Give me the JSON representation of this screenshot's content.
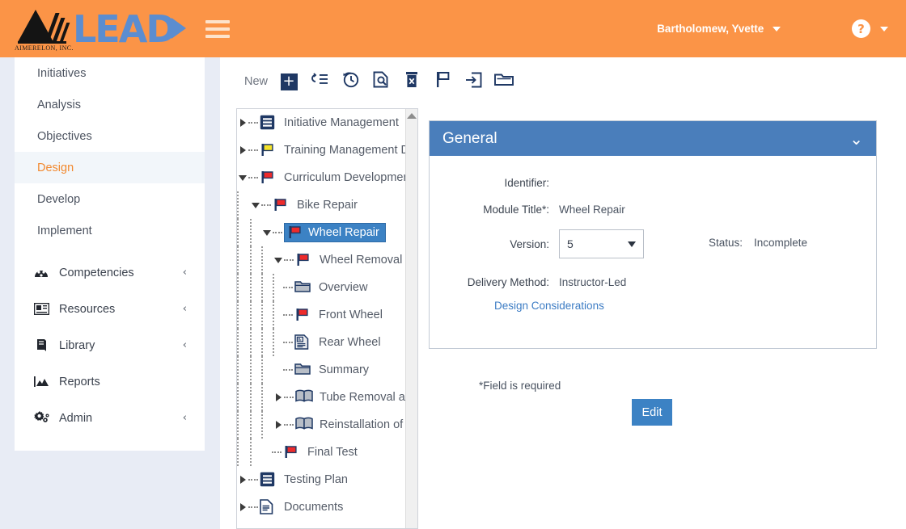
{
  "header": {
    "logo_word": "LEAD",
    "logo_sub": "AIMERELON, INC.",
    "menu_icon": "hamburger-icon",
    "user_name": "Bartholomew, Yvette",
    "help_glyph": "?"
  },
  "sidebar": {
    "items": [
      {
        "label": "Initiatives",
        "type": "link",
        "active": false
      },
      {
        "label": "Analysis",
        "type": "link",
        "active": false
      },
      {
        "label": "Objectives",
        "type": "link",
        "active": false
      },
      {
        "label": "Design",
        "type": "link",
        "active": true
      },
      {
        "label": "Develop",
        "type": "link",
        "active": false
      },
      {
        "label": "Implement",
        "type": "link",
        "active": false
      }
    ],
    "groups": [
      {
        "label": "Competencies",
        "icon": "competencies-icon",
        "chevron": "‹"
      },
      {
        "label": "Resources",
        "icon": "resources-icon",
        "chevron": "‹"
      },
      {
        "label": "Library",
        "icon": "library-icon",
        "chevron": "‹"
      },
      {
        "label": "Reports",
        "icon": "reports-icon",
        "chevron": ""
      },
      {
        "label": "Admin",
        "icon": "admin-gear-icon",
        "chevron": "‹"
      }
    ]
  },
  "toolbar": {
    "new_label": "New",
    "buttons": [
      {
        "name": "add-new-button",
        "icon": "plus-square-icon"
      },
      {
        "name": "reorder-button",
        "icon": "indent-list-icon"
      },
      {
        "name": "history-button",
        "icon": "clock-history-icon"
      },
      {
        "name": "preview-button",
        "icon": "document-search-icon"
      },
      {
        "name": "delete-button",
        "icon": "trash-icon"
      },
      {
        "name": "flag-button",
        "icon": "flag-icon"
      },
      {
        "name": "move-in-button",
        "icon": "arrow-into-box-icon"
      },
      {
        "name": "folder-button",
        "icon": "folder-icon"
      }
    ]
  },
  "tree": {
    "nodes": [
      {
        "label": "Initiative Management",
        "depth": 0,
        "toggle": "collapsed",
        "icon": "menu-blue-icon",
        "selected": false
      },
      {
        "label": "Training Management Doc",
        "depth": 0,
        "toggle": "collapsed",
        "icon": "flag-yellow-icon",
        "selected": false
      },
      {
        "label": "Curriculum Development",
        "depth": 0,
        "toggle": "expanded",
        "icon": "flag-red-icon",
        "selected": false
      },
      {
        "label": "Bike Repair",
        "depth": 1,
        "toggle": "expanded",
        "icon": "flag-red-icon",
        "selected": false
      },
      {
        "label": "Wheel Repair",
        "depth": 2,
        "toggle": "expanded",
        "icon": "flag-red-icon",
        "selected": true
      },
      {
        "label": "Wheel Removal",
        "depth": 3,
        "toggle": "expanded",
        "icon": "flag-red-icon",
        "selected": false
      },
      {
        "label": "Overview",
        "depth": 4,
        "toggle": "leaf",
        "icon": "folder-icon",
        "selected": false
      },
      {
        "label": "Front Wheel",
        "depth": 4,
        "toggle": "leaf",
        "icon": "flag-red-icon",
        "selected": false
      },
      {
        "label": "Rear Wheel",
        "depth": 4,
        "toggle": "leaf",
        "icon": "page-text-icon",
        "selected": false
      },
      {
        "label": "Summary",
        "depth": 4,
        "toggle": "leaf",
        "icon": "folder-icon",
        "selected": false
      },
      {
        "label": "Tube Removal a",
        "depth": 3,
        "toggle": "collapsed",
        "icon": "book-icon",
        "selected": false
      },
      {
        "label": "Reinstallation of",
        "depth": 3,
        "toggle": "collapsed",
        "icon": "book-icon",
        "selected": false
      },
      {
        "label": "Final Test",
        "depth": 2,
        "toggle": "leaf",
        "icon": "flag-red-icon",
        "selected": false
      },
      {
        "label": "Testing Plan",
        "depth": 0,
        "toggle": "collapsed",
        "icon": "menu-blue-icon",
        "selected": false
      },
      {
        "label": "Documents",
        "depth": 0,
        "toggle": "collapsed",
        "icon": "page-icon",
        "selected": false
      }
    ],
    "scrollbar_up_icon": "scroll-up-arrow-icon"
  },
  "general_panel": {
    "title": "General",
    "collapse_icon": "chevron-down-icon",
    "fields": {
      "identifier_label": "Identifier:",
      "identifier_value": "",
      "module_title_label": "Module Title*:",
      "module_title_value": "Wheel Repair",
      "version_label": "Version:",
      "version_value": "5",
      "status_label": "Status:",
      "status_value": "Incomplete",
      "delivery_label": "Delivery Method:",
      "delivery_value": "Instructor-Led"
    },
    "design_considerations_link": "Design Considerations"
  },
  "footer": {
    "required_note": "*Field is required",
    "edit_label": "Edit"
  },
  "colors": {
    "header_orange": "#fb9447",
    "accent_blue": "#4a7ebb",
    "button_blue": "#3c82c4",
    "active_text": "#f2892f",
    "tree_flag_red": "#ee2b2b",
    "tree_flag_yellow": "#f5e32a",
    "icon_navy": "#1f3864"
  }
}
